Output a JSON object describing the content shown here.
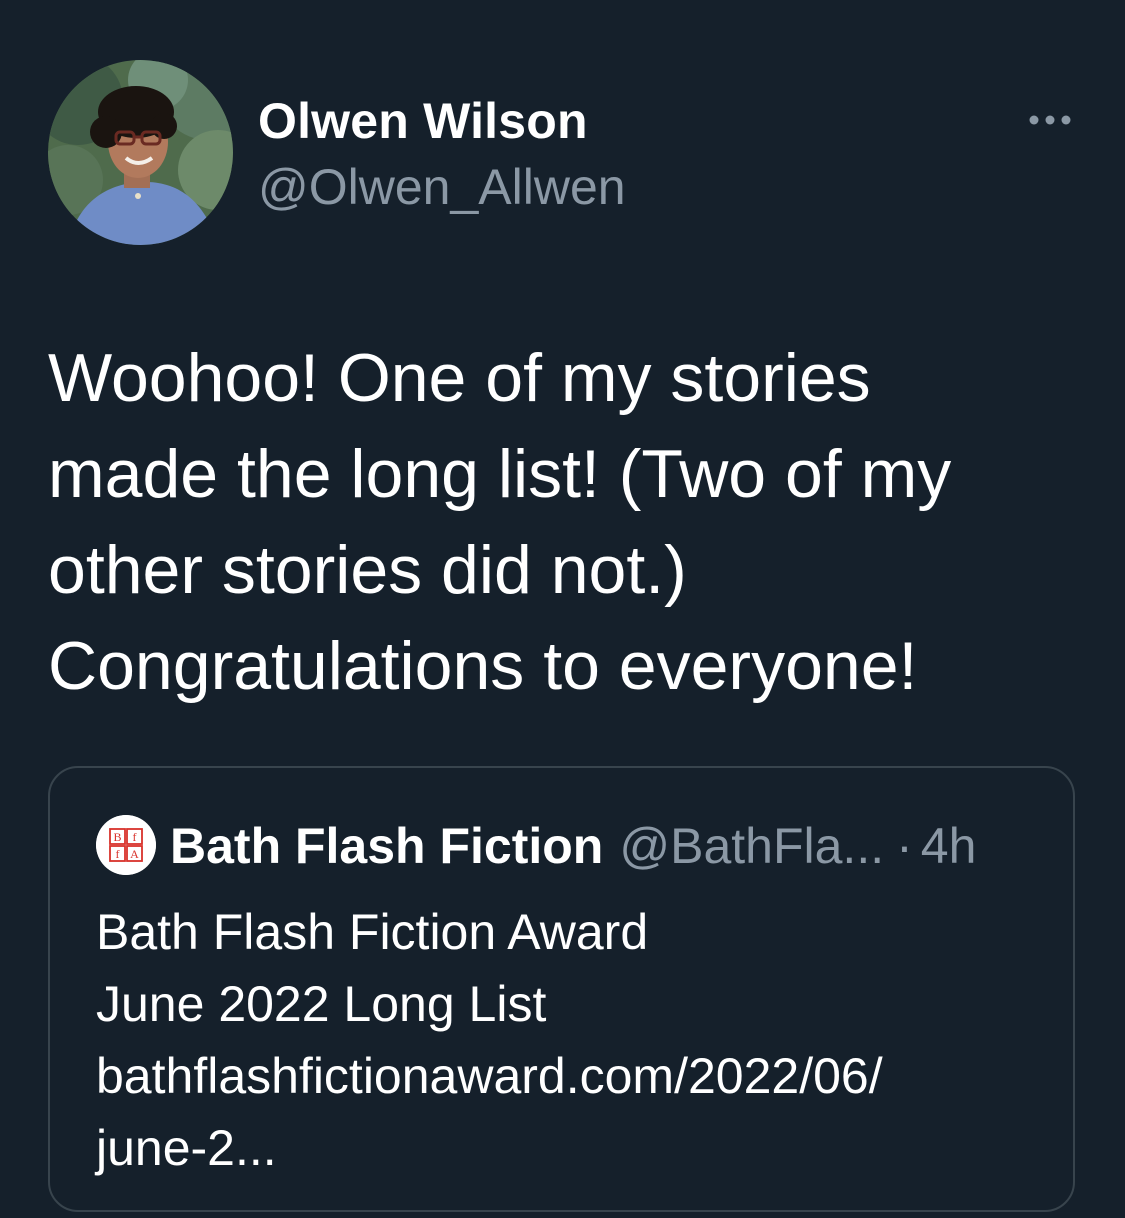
{
  "tweet": {
    "author": {
      "display_name": "Olwen Wilson",
      "handle": "@Olwen_Allwen",
      "avatar": "profile-photo"
    },
    "more_icon": "more-horizontal-icon",
    "text_lines": [
      "Woohoo! One of my stories",
      "made the long list! (Two of my",
      "other stories did not.)",
      "Congratulations to everyone!"
    ],
    "quoted_tweet": {
      "avatar_logo": {
        "letters": [
          "B",
          "f",
          "f",
          "A"
        ]
      },
      "display_name": "Bath Flash Fiction",
      "handle": "@BathFla...",
      "separator": "·",
      "time": "4h",
      "body_lines": [
        "Bath Flash Fiction Award",
        "June 2022 Long List",
        "bathflashfictionaward.com/2022/06/",
        "june-2..."
      ]
    }
  },
  "colors": {
    "background": "#15202b",
    "primary_text": "#ffffff",
    "secondary_text": "#8b98a5",
    "border": "#38444d",
    "logo_red": "#d9322b"
  }
}
